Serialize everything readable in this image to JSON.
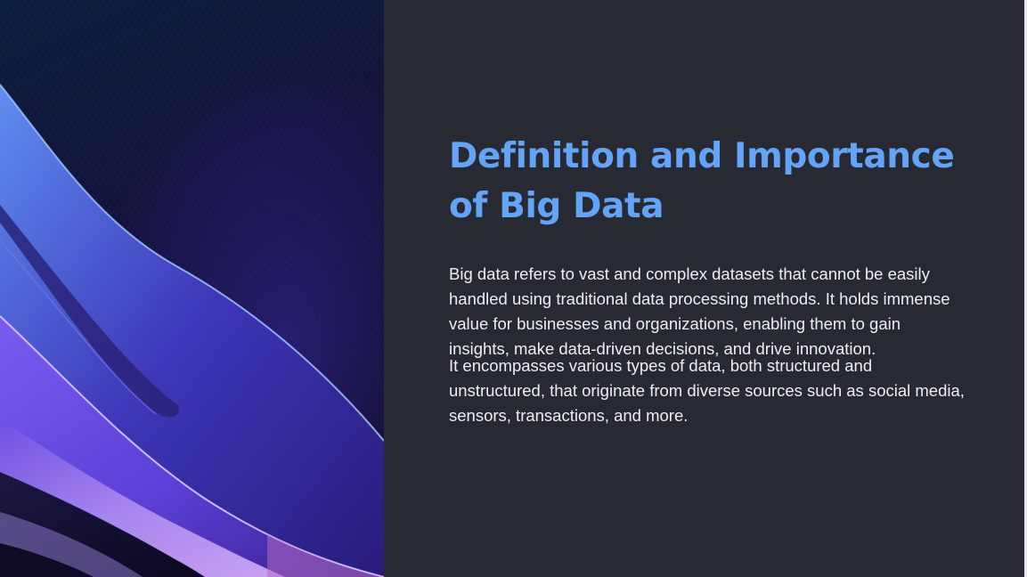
{
  "slide": {
    "title": "Definition and Importance of Big Data",
    "paragraphs": [
      "Big data refers to vast and complex datasets that cannot be easily handled using traditional data processing methods. It holds immense value for businesses and organizations, enabling them to gain insights, make data-driven decisions, and drive innovation.",
      "It encompasses various types of data, both structured and unstructured, that originate from diverse sources such as social media, sensors, transactions, and more."
    ]
  },
  "colors": {
    "background": "#272a32",
    "title": "#63a4f7",
    "body_text": "#eceef2",
    "artwork_deep": "#120f2e",
    "artwork_violet": "#5b3fd6",
    "artwork_lavender": "#b89af0"
  },
  "decoration": {
    "artwork": "abstract-purple-wave-image"
  }
}
